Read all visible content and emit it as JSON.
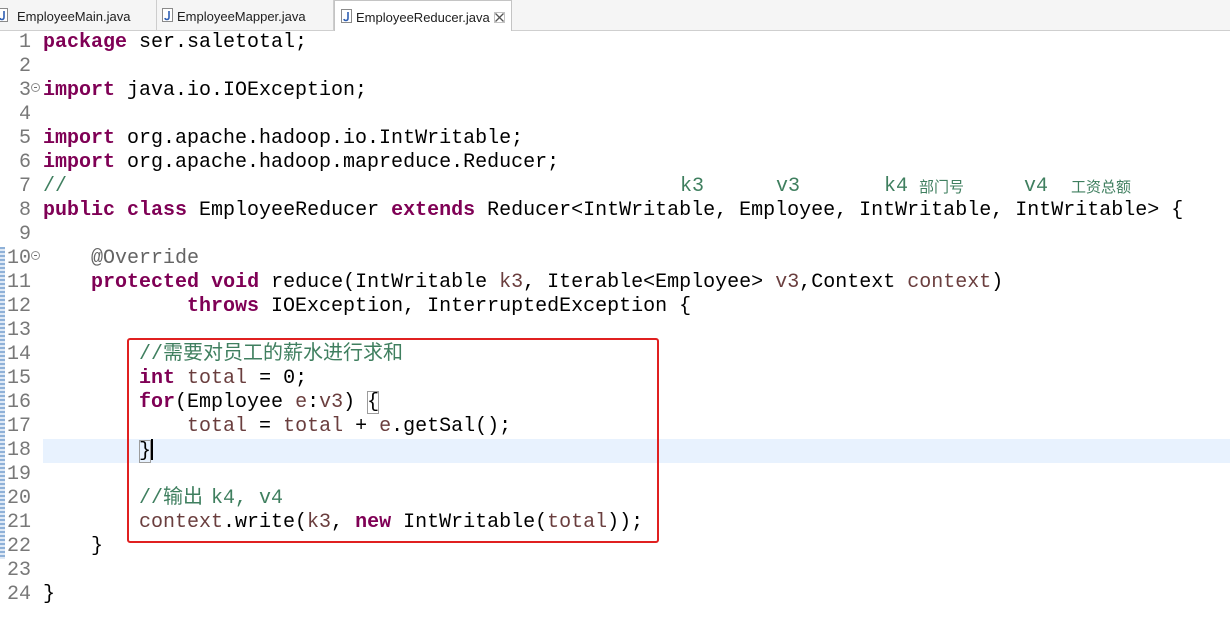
{
  "tabs": [
    {
      "label": "EmployeeMain.java",
      "icon": "java-file-icon",
      "active": false
    },
    {
      "label": "EmployeeMapper.java",
      "icon": "java-file-icon",
      "active": false
    },
    {
      "label": "EmployeeReducer.java",
      "icon": "java-file-icon",
      "active": true,
      "close_icon": "close-icon"
    }
  ],
  "editor": {
    "current_line": 18,
    "cursor_line": 18,
    "lines": [
      {
        "n": 1,
        "tokens": [
          {
            "t": "package",
            "c": "keyword"
          },
          {
            "t": " ser.saletotal;",
            "c": "text"
          }
        ]
      },
      {
        "n": 2,
        "tokens": []
      },
      {
        "n": 3,
        "fold": true,
        "tokens": [
          {
            "t": "import",
            "c": "keyword"
          },
          {
            "t": " java.io.IOException;",
            "c": "text"
          }
        ]
      },
      {
        "n": 4,
        "tokens": []
      },
      {
        "n": 5,
        "tokens": [
          {
            "t": "import",
            "c": "keyword"
          },
          {
            "t": " org.apache.hadoop.io.IntWritable;",
            "c": "text"
          }
        ]
      },
      {
        "n": 6,
        "tokens": [
          {
            "t": "import",
            "c": "keyword"
          },
          {
            "t": " org.apache.hadoop.mapreduce.Reducer;",
            "c": "text"
          }
        ]
      },
      {
        "n": 7,
        "tokens": [
          {
            "t": "//",
            "c": "comment"
          },
          {
            "t": "k3",
            "c": "comment"
          },
          {
            "t": "v3",
            "c": "comment"
          },
          {
            "t": "k4",
            "c": "comment"
          },
          {
            "t": "部门号",
            "c": "comment"
          },
          {
            "t": "v4",
            "c": "comment"
          },
          {
            "t": "工资总额",
            "c": "comment"
          }
        ]
      },
      {
        "n": 8,
        "tokens": [
          {
            "t": "public",
            "c": "keyword"
          },
          {
            "t": " ",
            "c": "text"
          },
          {
            "t": "class",
            "c": "keyword"
          },
          {
            "t": " EmployeeReducer ",
            "c": "text"
          },
          {
            "t": "extends",
            "c": "keyword"
          },
          {
            "t": " Reducer<IntWritable, Employee, IntWritable, IntWritable> {",
            "c": "text"
          }
        ]
      },
      {
        "n": 9,
        "tokens": []
      },
      {
        "n": 10,
        "fold": true,
        "tokens": [
          {
            "t": "    ",
            "c": "text"
          },
          {
            "t": "@Override",
            "c": "annotation"
          }
        ]
      },
      {
        "n": 11,
        "tokens": [
          {
            "t": "    ",
            "c": "text"
          },
          {
            "t": "protected",
            "c": "keyword"
          },
          {
            "t": " ",
            "c": "text"
          },
          {
            "t": "void",
            "c": "keyword"
          },
          {
            "t": " reduce(IntWritable ",
            "c": "text"
          },
          {
            "t": "k3",
            "c": "variable"
          },
          {
            "t": ", Iterable<Employee> ",
            "c": "text"
          },
          {
            "t": "v3",
            "c": "variable"
          },
          {
            "t": ",Context ",
            "c": "text"
          },
          {
            "t": "context",
            "c": "variable"
          },
          {
            "t": ")",
            "c": "text"
          }
        ]
      },
      {
        "n": 12,
        "tokens": [
          {
            "t": "            ",
            "c": "text"
          },
          {
            "t": "throws",
            "c": "keyword"
          },
          {
            "t": " IOException, InterruptedException {",
            "c": "text"
          }
        ]
      },
      {
        "n": 13,
        "tokens": []
      },
      {
        "n": 14,
        "tokens": [
          {
            "t": "        ",
            "c": "text"
          },
          {
            "t": "//",
            "c": "comment"
          },
          {
            "t": "需要对员工的薪水进行求和",
            "c": "comment"
          }
        ]
      },
      {
        "n": 15,
        "tokens": [
          {
            "t": "        ",
            "c": "text"
          },
          {
            "t": "int",
            "c": "keyword"
          },
          {
            "t": " ",
            "c": "text"
          },
          {
            "t": "total",
            "c": "variable"
          },
          {
            "t": " = 0;",
            "c": "text"
          }
        ]
      },
      {
        "n": 16,
        "tokens": [
          {
            "t": "        ",
            "c": "text"
          },
          {
            "t": "for",
            "c": "keyword"
          },
          {
            "t": "(Employee ",
            "c": "text"
          },
          {
            "t": "e",
            "c": "variable"
          },
          {
            "t": ":",
            "c": "text"
          },
          {
            "t": "v3",
            "c": "variable"
          },
          {
            "t": ") ",
            "c": "text"
          },
          {
            "t": "{",
            "c": "bracket"
          }
        ]
      },
      {
        "n": 17,
        "tokens": [
          {
            "t": "            ",
            "c": "text"
          },
          {
            "t": "total",
            "c": "variable"
          },
          {
            "t": " = ",
            "c": "text"
          },
          {
            "t": "total",
            "c": "variable"
          },
          {
            "t": " + ",
            "c": "text"
          },
          {
            "t": "e",
            "c": "variable"
          },
          {
            "t": ".getSal();",
            "c": "text"
          }
        ]
      },
      {
        "n": 18,
        "tokens": [
          {
            "t": "        ",
            "c": "text"
          },
          {
            "t": "}",
            "c": "bracket"
          }
        ]
      },
      {
        "n": 19,
        "tokens": []
      },
      {
        "n": 20,
        "tokens": [
          {
            "t": "        ",
            "c": "text"
          },
          {
            "t": "//",
            "c": "comment"
          },
          {
            "t": "输出",
            "c": "comment"
          },
          {
            "t": "k4, v4",
            "c": "comment"
          }
        ]
      },
      {
        "n": 21,
        "tokens": [
          {
            "t": "        ",
            "c": "text"
          },
          {
            "t": "context",
            "c": "variable"
          },
          {
            "t": ".write(",
            "c": "text"
          },
          {
            "t": "k3",
            "c": "variable"
          },
          {
            "t": ", ",
            "c": "text"
          },
          {
            "t": "new",
            "c": "keyword"
          },
          {
            "t": " IntWritable(",
            "c": "text"
          },
          {
            "t": "total",
            "c": "variable"
          },
          {
            "t": "));",
            "c": "text"
          }
        ]
      },
      {
        "n": 22,
        "tokens": [
          {
            "t": "    ",
            "c": "text"
          },
          {
            "t": "}",
            "c": "text"
          }
        ]
      },
      {
        "n": 23,
        "tokens": []
      },
      {
        "n": 24,
        "tokens": [
          {
            "t": "}",
            "c": "text"
          }
        ]
      }
    ]
  },
  "colors": {
    "keyword": "#7F0055",
    "comment": "#3F7F5F",
    "annotation": "#646464",
    "variable": "#6A3E3E",
    "text": "#000000",
    "bracket": "#000000",
    "current_line": "#E8F2FE",
    "highlight_box": "#E02020"
  }
}
